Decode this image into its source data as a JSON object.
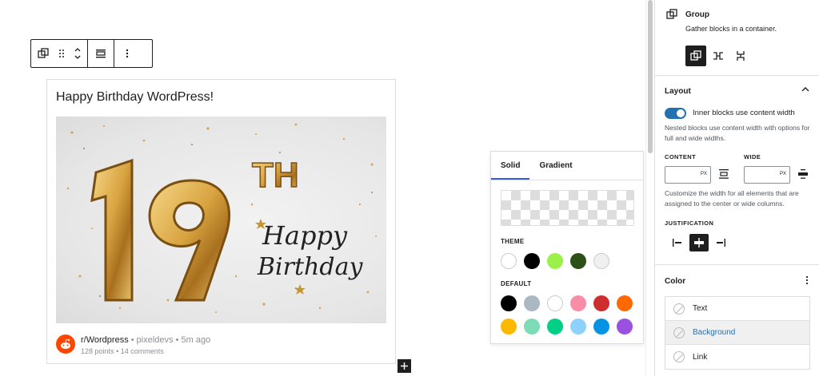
{
  "post": {
    "title": "Happy Birthday WordPress!",
    "image_alt": "19th Happy Birthday balloons",
    "image_text": {
      "number": "19",
      "suffix": "TH",
      "line1": "Happy",
      "line2": "Birthday"
    }
  },
  "reddit": {
    "subreddit": "r/Wordpress",
    "meta": "• pixeldevs • 5m ago",
    "points": "128 points",
    "comments": "• 14 comments"
  },
  "popover": {
    "tabs": [
      "Solid",
      "Gradient"
    ],
    "active_tab": "Solid",
    "theme_label": "THEME",
    "default_label": "DEFAULT",
    "theme_colors": [
      "#ffffff",
      "#000000",
      "#9bf14a",
      "#2d5016",
      "#f0f0f0"
    ],
    "default_colors_row1": [
      "#000000",
      "#abb8c3",
      "#ffffff",
      "#f78da7",
      "#cf2e2e",
      "#ff6900"
    ],
    "default_colors_row2": [
      "#fcb900",
      "#7bdcb5",
      "#00d084",
      "#8ed1fc",
      "#0693e3",
      "#9b51e0"
    ]
  },
  "sidebar": {
    "block": {
      "title": "Group",
      "description": "Gather blocks in a container."
    },
    "layout": {
      "title": "Layout",
      "toggle_label": "Inner blocks use content width",
      "toggle_on": true,
      "help1": "Nested blocks use content width with options for full and wide widths.",
      "content_label": "CONTENT",
      "wide_label": "WIDE",
      "unit": "PX",
      "content_value": "",
      "wide_value": "",
      "help2": "Customize the width for all elements that are assigned to the center or wide columns.",
      "justification_label": "JUSTIFICATION"
    },
    "color": {
      "title": "Color",
      "items": [
        "Text",
        "Background",
        "Link"
      ],
      "active_item": "Background"
    }
  },
  "colors": {
    "accent": "#2271b1",
    "wp_blue": "#3858e9",
    "dark": "#1e1e1e"
  }
}
